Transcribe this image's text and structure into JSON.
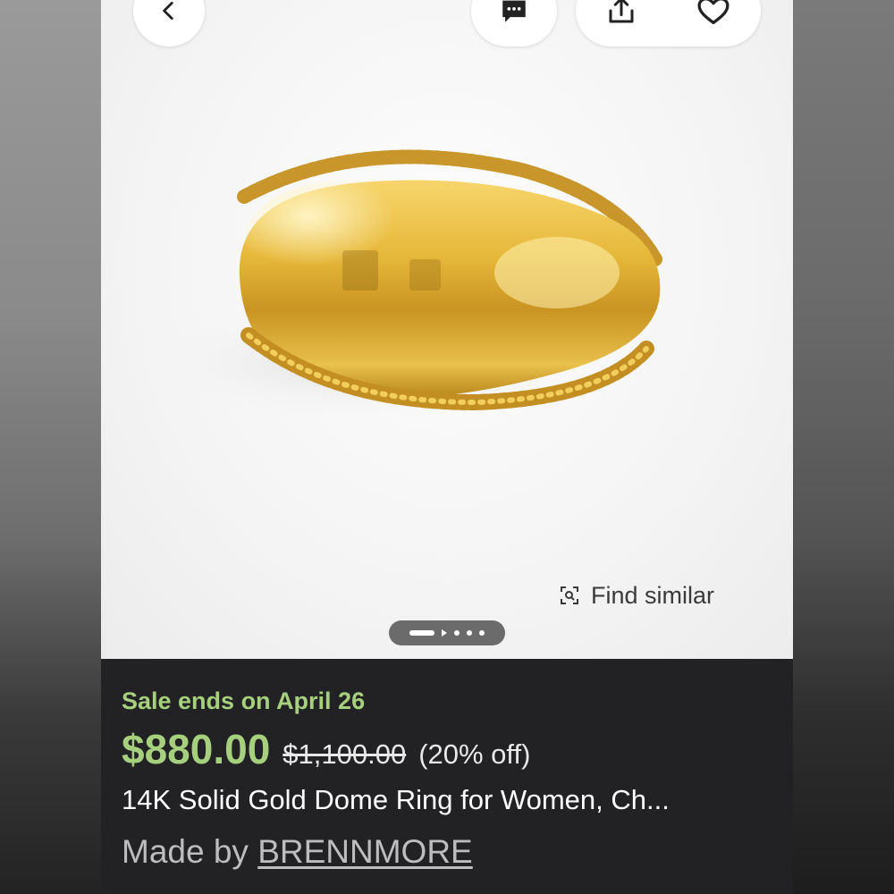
{
  "header": {
    "back_icon": "chevron-left-icon",
    "message_icon": "chat-bubble-icon",
    "share_icon": "share-icon",
    "favorite_icon": "heart-icon"
  },
  "image": {
    "subject": "gold-dome-ring",
    "find_similar_icon": "visual-search-icon",
    "find_similar_label": "Find similar",
    "carousel_total_indicators": 5,
    "carousel_active_index": 0
  },
  "listing": {
    "sale_ends": "Sale ends on April 26",
    "price": "$880.00",
    "original_price": "$1,100.00",
    "discount": "(20% off)",
    "title": "14K Solid Gold Dome Ring for Women, Ch...",
    "made_by_prefix": "Made by ",
    "shop_name": "BRENNMORE"
  },
  "colors": {
    "sale_green": "#a6d07d",
    "panel_dark": "#222225",
    "gold": "#d4a52a"
  }
}
